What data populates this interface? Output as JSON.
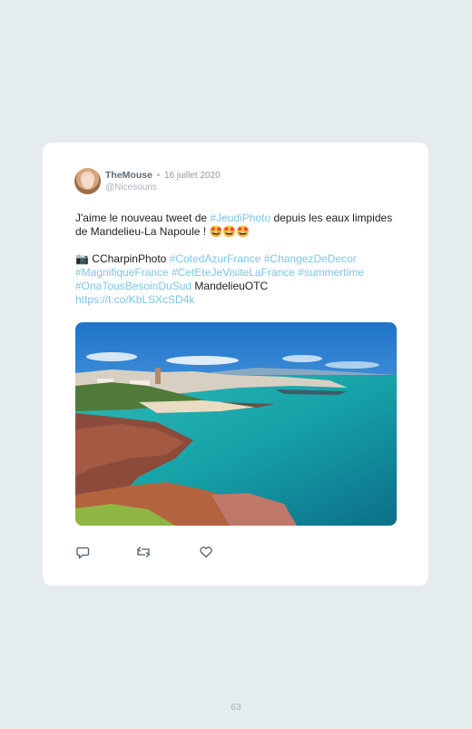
{
  "tweet": {
    "user_name": "TheMouse",
    "separator": "•",
    "date": "16 juillet 2020",
    "handle": "@Nicesouris",
    "line1_a": "J'aime le nouveau tweet de ",
    "line1_tag": "#JeudiPhoto",
    "line1_b": " depuis les eaux limpides de Mandelieu-La Napoule ! ",
    "line1_emoji": "🤩🤩🤩",
    "camera_emoji": "📷",
    "credit": " CCharpinPhoto ",
    "hashtags": [
      "#CotedAzurFrance",
      "#ChangezDeDecor",
      "#MagnifiqueFrance",
      "#CetEteJeVisiteLaFrance",
      "#summertime",
      "#OnaTousBesoinDuSud"
    ],
    "place": " MandelieuOTC",
    "link": "https://t.co/KbLSXcSD4k",
    "photo_icon": "coastline-photo"
  },
  "actions": {
    "reply_icon": "reply-icon",
    "retweet_icon": "retweet-icon",
    "like_icon": "heart-icon"
  },
  "page": {
    "number": "63"
  }
}
